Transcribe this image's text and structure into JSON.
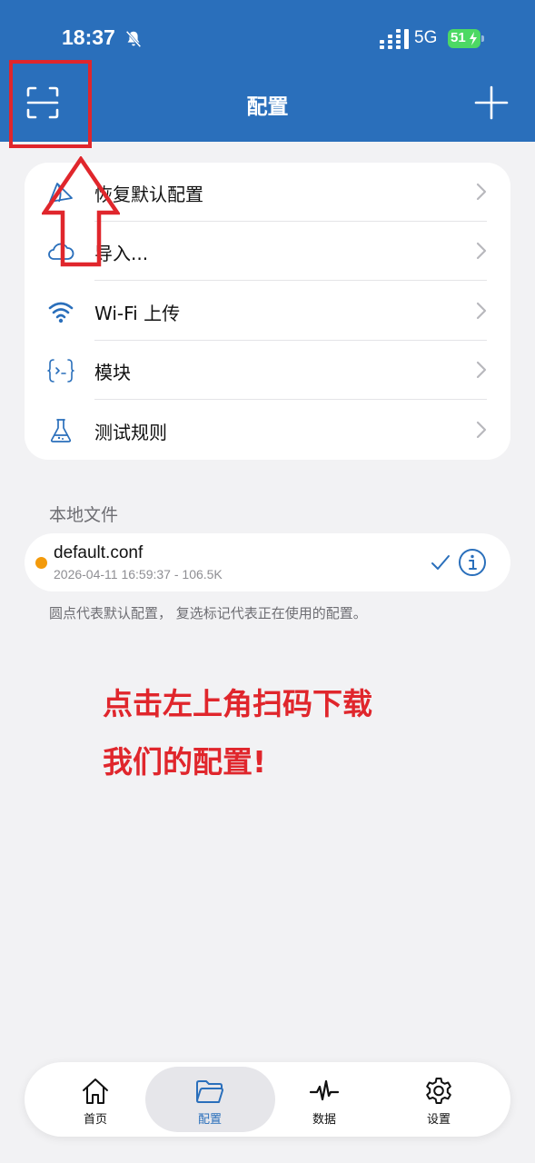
{
  "status_bar": {
    "time": "18:37",
    "network": "5G",
    "battery": "51"
  },
  "header": {
    "title": "配置"
  },
  "menu": {
    "items": [
      {
        "label": "恢复默认配置",
        "icon": "restore-icon"
      },
      {
        "label": "导入...",
        "icon": "cloud-icon"
      },
      {
        "label": "Wi-Fi 上传",
        "icon": "wifi-icon"
      },
      {
        "label": "模块",
        "icon": "module-braces-icon"
      },
      {
        "label": "测试规则",
        "icon": "flask-icon"
      }
    ]
  },
  "local_files": {
    "title": "本地文件",
    "files": [
      {
        "name": "default.conf",
        "meta": "2026-04-11 16:59:37 - 106.5K"
      }
    ],
    "footnote": "圆点代表默认配置， 复选标记代表正在使用的配置。"
  },
  "annotation": {
    "line1": "点击左上角扫码下载",
    "line2": "我们的配置!"
  },
  "tabbar": {
    "tabs": [
      {
        "label": "首页",
        "icon": "home-icon"
      },
      {
        "label": "配置",
        "icon": "folder-icon"
      },
      {
        "label": "数据",
        "icon": "activity-icon"
      },
      {
        "label": "设置",
        "icon": "gear-icon"
      }
    ],
    "active": "配置"
  },
  "colors": {
    "header_blue": "#2a6fbb",
    "annotation_red": "#e0262c",
    "default_dot": "#f39a0b"
  }
}
